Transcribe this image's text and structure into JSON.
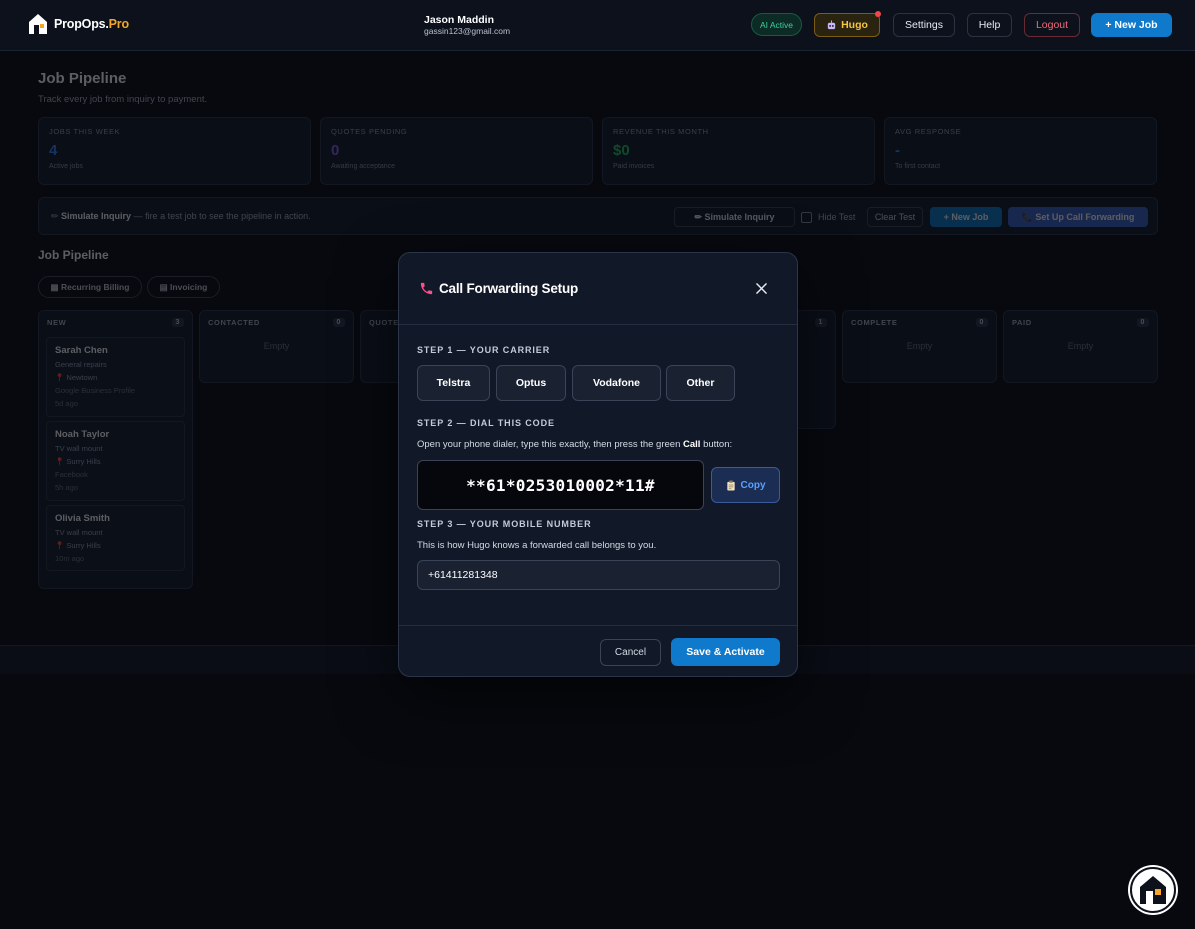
{
  "brand": {
    "name_main": "PropOps.",
    "name_accent": "Pro"
  },
  "user": {
    "name": "Jason Maddin",
    "email": "gassin123@gmail.com"
  },
  "nav": {
    "ai_status": "AI Active",
    "hugo_label": "Hugo",
    "settings": "Settings",
    "help": "Help",
    "logout": "Logout",
    "new_job": "+ New Job"
  },
  "page": {
    "title": "Job Pipeline",
    "subtitle": "Track every job from inquiry to payment.",
    "stats": [
      {
        "label": "JOBS THIS WEEK",
        "value": "4",
        "note": "Active jobs",
        "color": "#3b82f6"
      },
      {
        "label": "QUOTES PENDING",
        "value": "0",
        "note": "Awaiting acceptance",
        "color": "#8b5cf6"
      },
      {
        "label": "REVENUE THIS MONTH",
        "value": "$0",
        "note": "Paid invoices",
        "color": "#22c55e"
      },
      {
        "label": "AVG RESPONSE",
        "value": "-",
        "note": "To first contact",
        "color": "#3b82f6"
      }
    ],
    "simulate": {
      "title": "Simulate Inquiry",
      "text": " — fire a test job to see the pipeline in action.",
      "button": "Simulate Inquiry",
      "hide_test": "Hide Test",
      "clear_test": "Clear Test",
      "new_job": "+ New Job",
      "call_forwarding": "Set Up Call Forwarding"
    },
    "section_title": "Job Pipeline",
    "chips": [
      "Recurring Billing",
      "Invoicing"
    ],
    "columns": [
      {
        "name": "NEW",
        "count": "3"
      },
      {
        "name": "CONTACTED",
        "count": "0",
        "empty": "Empty"
      },
      {
        "name": "QUOTE"
      },
      {
        "name": "",
        "count": "1"
      },
      {
        "name": "COMPLETE",
        "count": "0",
        "empty": "Empty"
      },
      {
        "name": "PAID",
        "count": "0",
        "empty": "Empty"
      }
    ],
    "cards": [
      {
        "name": "Sarah Chen",
        "job": "General repairs",
        "suburb": "📍 Newtown",
        "source": "Google Business Profile",
        "time": "5d ago"
      },
      {
        "name": "Noah Taylor",
        "job": "TV wall mount",
        "suburb": "📍 Surry Hills",
        "source": "Facebook",
        "time": "5h ago"
      },
      {
        "name": "Olivia Smith",
        "job": "TV wall mount",
        "suburb": "📍 Surry Hills",
        "time": "10m ago"
      }
    ]
  },
  "modal": {
    "title": "Call Forwarding Setup",
    "step1": "STEP 1 — YOUR CARRIER",
    "carriers": [
      "Telstra",
      "Optus",
      "Vodafone",
      "Other"
    ],
    "step2": "STEP 2 — DIAL THIS CODE",
    "step2_text_a": "Open your phone dialer, type this exactly, then press the green ",
    "step2_text_b": "Call",
    "step2_text_c": " button:",
    "code": "**61*0253010002*11#",
    "copy": "Copy",
    "step3": "STEP 3 — YOUR MOBILE NUMBER",
    "step3_text": "This is how Hugo knows a forwarded call belongs to you.",
    "mobile_value": "+61411281348",
    "cancel": "Cancel",
    "save": "Save & Activate"
  },
  "icons": {
    "logo": "house-logo-icon",
    "hugo": "robot-icon",
    "phone": "phone-icon",
    "close": "close-icon",
    "copy": "clipboard-icon",
    "widget": "house-chat-icon"
  },
  "colors": {
    "primary": "#0f7acb",
    "accent": "#f5a623",
    "phone_pink": "#ff4f8b"
  }
}
